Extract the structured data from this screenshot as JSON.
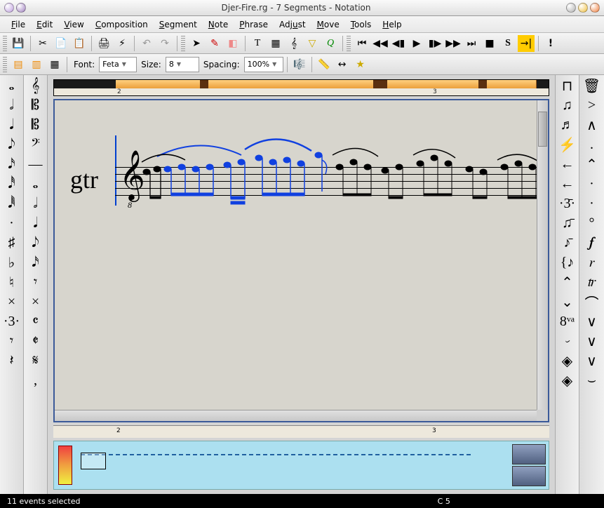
{
  "window": {
    "title": "Djer-Fire.rg - 7 Segments - Notation"
  },
  "menu": [
    "File",
    "Edit",
    "View",
    "Composition",
    "Segment",
    "Note",
    "Phrase",
    "Adjust",
    "Move",
    "Tools",
    "Help"
  ],
  "toolbar2": {
    "font_label": "Font:",
    "font_value": "Feta",
    "size_label": "Size:",
    "size_value": "8",
    "spacing_label": "Spacing:",
    "spacing_value": "100%"
  },
  "ruler": {
    "marks": [
      "2",
      "3"
    ]
  },
  "score": {
    "instrument": "gtr",
    "clef_sub": "8"
  },
  "status": {
    "left": "11 events selected",
    "right": "C 5"
  },
  "left_palette": [
    "𝅝",
    "𝅗𝅥",
    "𝅘𝅥",
    "𝅘𝅥𝅮",
    "𝅘𝅥𝅯",
    "𝅘𝅥𝅰",
    "𝅘𝅥𝅱",
    "·",
    "♯",
    "♭",
    "♮",
    "×",
    "·3·",
    "𝄾",
    "𝄽"
  ],
  "left_palette2": [
    "𝄞",
    "𝄡",
    "𝄡",
    "𝄢",
    "—",
    "𝅝",
    "𝅗𝅥",
    "𝅘𝅥",
    "𝅘𝅥𝅮",
    "𝅘𝅥𝅯",
    "𝄾",
    "×",
    "𝄴",
    "𝄵",
    "𝄋",
    ","
  ],
  "right_palette": [
    "⊓",
    "♫",
    "♬",
    "⚡",
    "←",
    "←",
    "·3̄·",
    "♫̄",
    "♪̄",
    "{♪",
    "⌃",
    "⌄",
    "8ᵛᵃ",
    "𝆤",
    "◈",
    "◈"
  ],
  "far_right": [
    "🗑",
    ">",
    "∧",
    ".",
    "⌃",
    "·",
    "·",
    "°",
    "𝆑",
    "𝆌",
    "𝆖",
    "⌒",
    "∨",
    "∨",
    "∨",
    "⌣"
  ],
  "icons": {
    "save": "💾",
    "cut": "✂",
    "copy": "📄",
    "paste": "📋",
    "print": "🖨",
    "flash": "⚡",
    "undo": "↶",
    "redo": "↷",
    "pointer": "➤",
    "pencil": "✎",
    "eraser": "◧",
    "text": "T",
    "grid": "▦",
    "clef_tool": "𝄞",
    "filter": "▽",
    "q": "Q",
    "rewind_start": "⏮",
    "rewind": "◀◀",
    "step_back": "◀▮",
    "play": "▶",
    "step_fwd": "▮▶",
    "ffwd": "▶▶",
    "end": "⏭",
    "stop": "■",
    "solo": "S",
    "loop_end": "→|",
    "panic": "!",
    "layout1": "▤",
    "layout2": "▥",
    "layout3": "▦",
    "zoom_ruler": "📏",
    "span": "↔",
    "star": "★"
  }
}
